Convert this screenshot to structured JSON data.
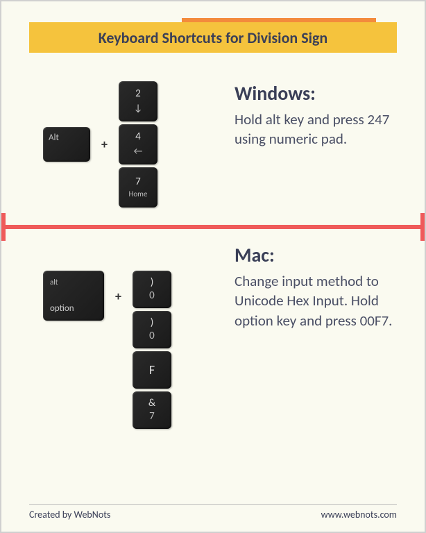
{
  "header": {
    "title": "Keyboard Shortcuts for Division Sign"
  },
  "windows": {
    "title": "Windows:",
    "text": "Hold alt key and press 247 using numeric pad.",
    "key_alt": "Alt",
    "plus": "+",
    "keys": [
      {
        "top": "2",
        "bottom": "↓"
      },
      {
        "top": "4",
        "bottom": "←"
      },
      {
        "top": "7",
        "bottom": "Home"
      }
    ]
  },
  "mac": {
    "title": "Mac:",
    "text": "Change input method to Unicode Hex Input. Hold option key and press 00F7.",
    "key_option_top": "alt",
    "key_option_bottom": "option",
    "plus": "+",
    "keys": [
      {
        "top": ")",
        "bottom": "0"
      },
      {
        "top": ")",
        "bottom": "0"
      },
      {
        "top": "F",
        "bottom": ""
      },
      {
        "top": "&",
        "bottom": "7"
      }
    ]
  },
  "footer": {
    "left": "Created by WebNots",
    "right": "www.webnots.com"
  }
}
